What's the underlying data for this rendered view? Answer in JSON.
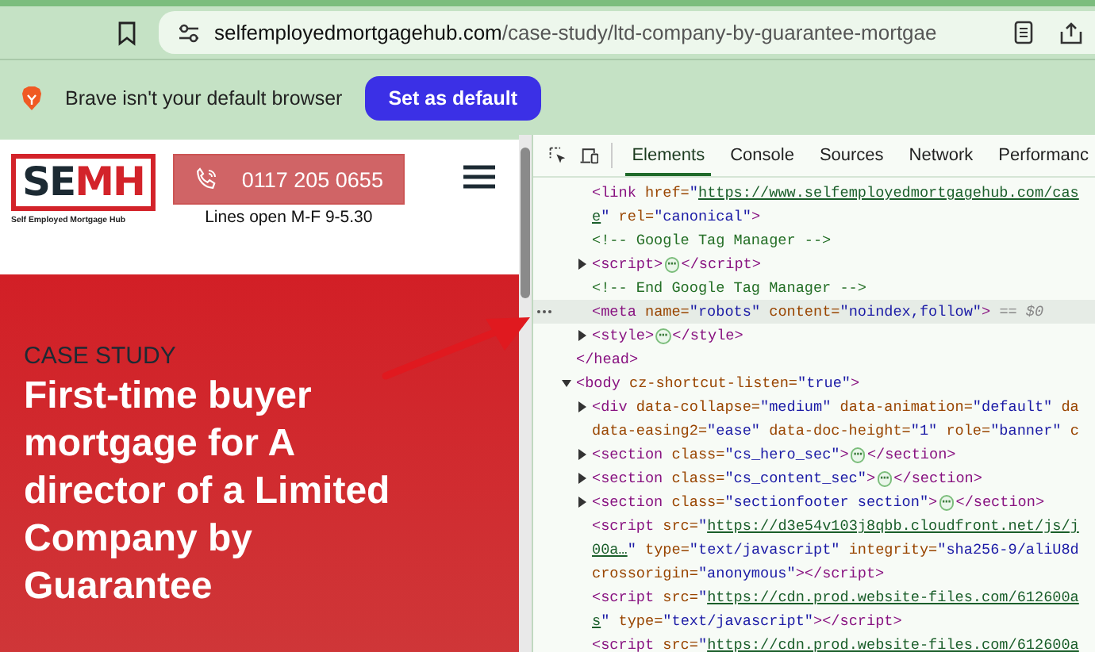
{
  "browser": {
    "url_domain": "selfemployedmortgagehub.com",
    "url_path": "/case-study/ltd-company-by-guarantee-mortgae",
    "infobar": {
      "message": "Brave isn't your default browser",
      "button": "Set as default"
    }
  },
  "page": {
    "logo": {
      "parts": [
        {
          "text": "SE",
          "kind": "dark"
        },
        {
          "text": "MH",
          "kind": "accent"
        }
      ],
      "tagline": "Self Employed Mortgage Hub"
    },
    "phone": "0117 205 0655",
    "hours": "Lines open M-F 9-5.30",
    "hero": {
      "eyebrow": "CASE STUDY",
      "title": "First-time buyer mortgage for A director of a Limited Company by Guarantee"
    }
  },
  "devtools": {
    "tabs": [
      {
        "label": "Elements",
        "selected": true
      },
      {
        "label": "Console",
        "selected": false
      },
      {
        "label": "Sources",
        "selected": false
      },
      {
        "label": "Network",
        "selected": false
      },
      {
        "label": "Performanc",
        "selected": false
      }
    ],
    "tree": [
      {
        "selected": false,
        "children": [
          {
            "lines": [
              [
                {
                  "text": "<link",
                  "kind": "tag"
                },
                {
                  "text": " href=",
                  "kind": "attr"
                },
                {
                  "text": "\"",
                  "kind": "val"
                },
                {
                  "text": "https://www.selfemployedmortgagehub.com/cas",
                  "kind": "link"
                }
              ],
              [
                {
                  "text": "e",
                  "kind": "link"
                },
                {
                  "text": "\"",
                  "kind": "val"
                },
                {
                  "text": " rel=",
                  "kind": "attr"
                },
                {
                  "text": "\"canonical\"",
                  "kind": "val"
                },
                {
                  "text": ">",
                  "kind": "tag"
                }
              ]
            ],
            "selected": false
          },
          {
            "lines": [
              [
                {
                  "text": "<!-- Google Tag Manager -->",
                  "kind": "comment"
                }
              ]
            ],
            "selected": false
          },
          {
            "lines": [
              [
                {
                  "text": "<script>",
                  "kind": "tag"
                },
                {
                  "text": "⋯",
                  "kind": "more"
                },
                {
                  "text": "</script>",
                  "kind": "tag"
                }
              ]
            ],
            "expanded": false,
            "selected": false
          },
          {
            "lines": [
              [
                {
                  "text": "<!-- End Google Tag Manager -->",
                  "kind": "comment"
                }
              ]
            ],
            "selected": false
          },
          {
            "lines": [
              [
                {
                  "text": "<meta",
                  "kind": "tag"
                },
                {
                  "text": " name=",
                  "kind": "attr"
                },
                {
                  "text": "\"robots\"",
                  "kind": "val"
                },
                {
                  "text": " content=",
                  "kind": "attr"
                },
                {
                  "text": "\"noindex,follow\"",
                  "kind": "val"
                },
                {
                  "text": ">",
                  "kind": "tag"
                },
                {
                  "text": " == $0",
                  "kind": "dim"
                }
              ]
            ],
            "selected": true
          },
          {
            "lines": [
              [
                {
                  "text": "<style>",
                  "kind": "tag"
                },
                {
                  "text": "⋯",
                  "kind": "more"
                },
                {
                  "text": "</style>",
                  "kind": "tag"
                }
              ]
            ],
            "expanded": false,
            "selected": false
          }
        ],
        "closing": [
          {
            "text": "</head>",
            "kind": "tag"
          }
        ]
      },
      {
        "lines": [
          [
            {
              "text": "<body",
              "kind": "tag"
            },
            {
              "text": " cz-shortcut-listen=",
              "kind": "attr"
            },
            {
              "text": "\"true\"",
              "kind": "val"
            },
            {
              "text": ">",
              "kind": "tag"
            }
          ]
        ],
        "expanded": true,
        "selected": false,
        "children": [
          {
            "lines": [
              [
                {
                  "text": "<div",
                  "kind": "tag"
                },
                {
                  "text": " data-collapse=",
                  "kind": "attr"
                },
                {
                  "text": "\"medium\"",
                  "kind": "val"
                },
                {
                  "text": " data-animation=",
                  "kind": "attr"
                },
                {
                  "text": "\"default\"",
                  "kind": "val"
                },
                {
                  "text": " da",
                  "kind": "attr"
                }
              ],
              [
                {
                  "text": "data-easing2=",
                  "kind": "attr"
                },
                {
                  "text": "\"ease\"",
                  "kind": "val"
                },
                {
                  "text": " data-doc-height=",
                  "kind": "attr"
                },
                {
                  "text": "\"1\"",
                  "kind": "val"
                },
                {
                  "text": " role=",
                  "kind": "attr"
                },
                {
                  "text": "\"banner\"",
                  "kind": "val"
                },
                {
                  "text": " c",
                  "kind": "attr"
                }
              ]
            ],
            "expanded": false,
            "selected": false
          },
          {
            "lines": [
              [
                {
                  "text": "<section",
                  "kind": "tag"
                },
                {
                  "text": " class=",
                  "kind": "attr"
                },
                {
                  "text": "\"cs_hero_sec\"",
                  "kind": "val"
                },
                {
                  "text": ">",
                  "kind": "tag"
                },
                {
                  "text": "⋯",
                  "kind": "more"
                },
                {
                  "text": "</section>",
                  "kind": "tag"
                }
              ]
            ],
            "expanded": false,
            "selected": false
          },
          {
            "lines": [
              [
                {
                  "text": "<section",
                  "kind": "tag"
                },
                {
                  "text": " class=",
                  "kind": "attr"
                },
                {
                  "text": "\"cs_content_sec\"",
                  "kind": "val"
                },
                {
                  "text": ">",
                  "kind": "tag"
                },
                {
                  "text": "⋯",
                  "kind": "more"
                },
                {
                  "text": "</section>",
                  "kind": "tag"
                }
              ]
            ],
            "expanded": false,
            "selected": false
          },
          {
            "lines": [
              [
                {
                  "text": "<section",
                  "kind": "tag"
                },
                {
                  "text": " class=",
                  "kind": "attr"
                },
                {
                  "text": "\"sectionfooter section\"",
                  "kind": "val"
                },
                {
                  "text": ">",
                  "kind": "tag"
                },
                {
                  "text": "⋯",
                  "kind": "more"
                },
                {
                  "text": "</section>",
                  "kind": "tag"
                }
              ]
            ],
            "expanded": false,
            "selected": false
          },
          {
            "lines": [
              [
                {
                  "text": "<script",
                  "kind": "tag"
                },
                {
                  "text": " src=",
                  "kind": "attr"
                },
                {
                  "text": "\"",
                  "kind": "val"
                },
                {
                  "text": "https://d3e54v103j8qbb.cloudfront.net/js/j",
                  "kind": "link"
                }
              ],
              [
                {
                  "text": "00a…",
                  "kind": "link"
                },
                {
                  "text": "\"",
                  "kind": "val"
                },
                {
                  "text": " type=",
                  "kind": "attr"
                },
                {
                  "text": "\"text/javascript\"",
                  "kind": "val"
                },
                {
                  "text": " integrity=",
                  "kind": "attr"
                },
                {
                  "text": "\"sha256-9/aliU8d",
                  "kind": "val"
                }
              ],
              [
                {
                  "text": "crossorigin=",
                  "kind": "attr"
                },
                {
                  "text": "\"anonymous\"",
                  "kind": "val"
                },
                {
                  "text": "></script>",
                  "kind": "tag"
                }
              ]
            ],
            "selected": false
          },
          {
            "lines": [
              [
                {
                  "text": "<script",
                  "kind": "tag"
                },
                {
                  "text": " src=",
                  "kind": "attr"
                },
                {
                  "text": "\"",
                  "kind": "val"
                },
                {
                  "text": "https://cdn.prod.website-files.com/612600a",
                  "kind": "link"
                }
              ],
              [
                {
                  "text": "s",
                  "kind": "link"
                },
                {
                  "text": "\"",
                  "kind": "val"
                },
                {
                  "text": " type=",
                  "kind": "attr"
                },
                {
                  "text": "\"text/javascript\"",
                  "kind": "val"
                },
                {
                  "text": "></script>",
                  "kind": "tag"
                }
              ]
            ],
            "selected": false
          },
          {
            "lines": [
              [
                {
                  "text": "<script",
                  "kind": "tag"
                },
                {
                  "text": " src=",
                  "kind": "attr"
                },
                {
                  "text": "\"",
                  "kind": "val"
                },
                {
                  "text": "https://cdn.prod.website-files.com/612600a",
                  "kind": "link"
                }
              ]
            ],
            "selected": false
          }
        ]
      }
    ]
  }
}
